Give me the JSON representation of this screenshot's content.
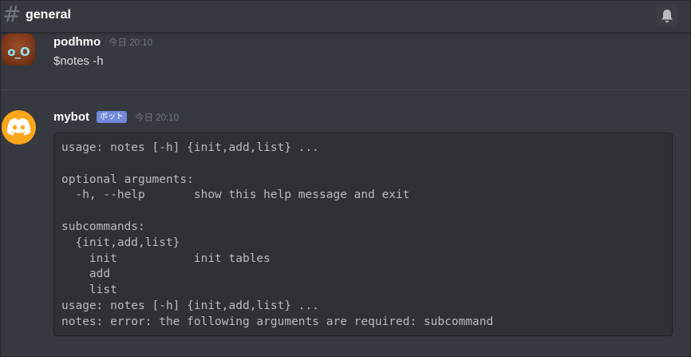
{
  "header": {
    "channel_name": "general",
    "icons": {
      "channel": "hash-icon",
      "notifications": "bell-icon"
    }
  },
  "messages": [
    {
      "author": "podhmo",
      "timestamp": "今日 20:10",
      "avatar_text": "o_O",
      "text": "$notes -h"
    },
    {
      "author": "mybot",
      "bot_tag": "ボット",
      "timestamp": "今日 20:10",
      "code": "usage: notes [-h] {init,add,list} ...\n\noptional arguments:\n  -h, --help       show this help message and exit\n\nsubcommands:\n  {init,add,list}\n    init           init tables\n    add\n    list\nusage: notes [-h] {init,add,list} ...\nnotes: error: the following arguments are required: subcommand"
    }
  ],
  "colors": {
    "background": "#36393f",
    "code_background": "#2f3136",
    "bot_tag": "#7289da",
    "bot_avatar": "#faa61a",
    "timestamp": "#72767d"
  }
}
